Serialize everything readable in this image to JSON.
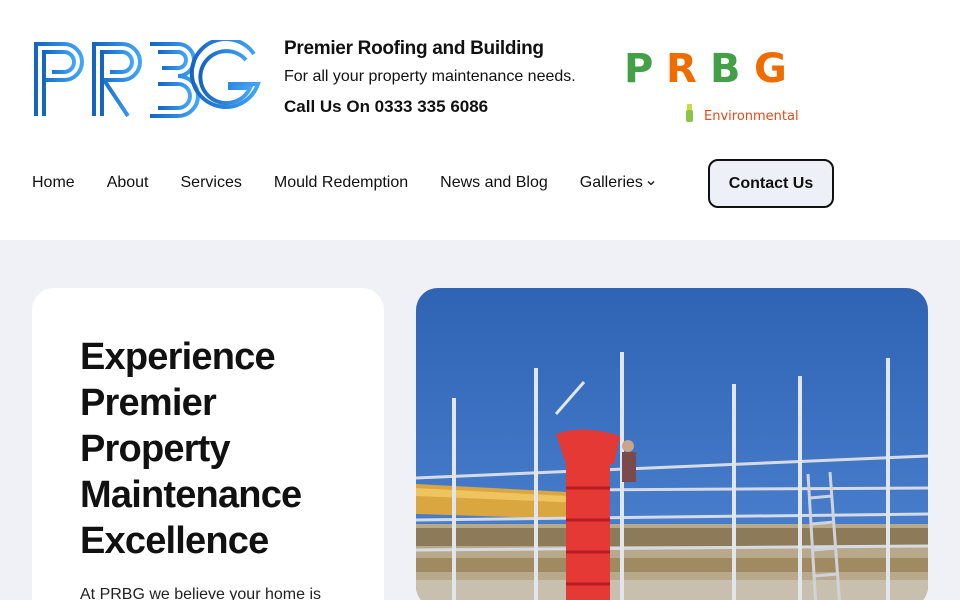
{
  "header": {
    "logo_text": "PRBG",
    "title": "Premier Roofing and Building",
    "subtitle": "For all your property maintenance needs.",
    "phone": "Call Us On 0333 335 6086",
    "env_logo_text": "PRBG",
    "env_logo_subtext": "Environmental"
  },
  "nav": {
    "items": [
      {
        "label": "Home"
      },
      {
        "label": "About"
      },
      {
        "label": "Services"
      },
      {
        "label": "Mould Redemption"
      },
      {
        "label": "News and Blog"
      },
      {
        "label": "Galleries"
      }
    ],
    "cta_label": "Contact Us"
  },
  "hero": {
    "heading_lines": [
      "Experience",
      "Premier",
      "Property",
      "Maintenance",
      "Excellence"
    ],
    "intro": "At PRBG we believe your home is"
  },
  "colors": {
    "brand_blue": "#1e88e5",
    "env_green": "#43a047",
    "env_orange": "#ef6c00",
    "hero_bg": "#f0f1f7",
    "sky": "#3a6fc0"
  },
  "icons": {
    "galleries_dropdown": "chevron-down-icon",
    "env_logo_mark": "spray-bottle-icon"
  }
}
